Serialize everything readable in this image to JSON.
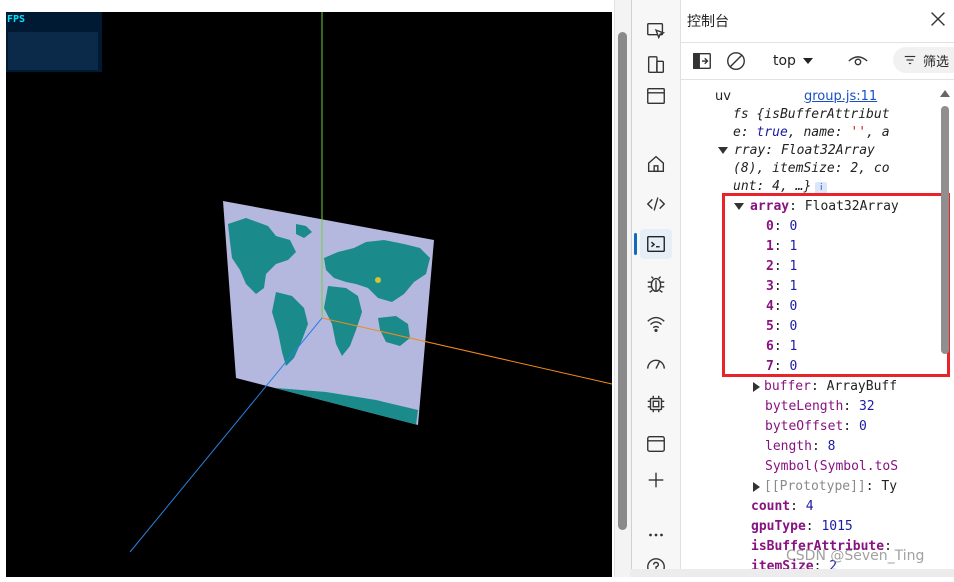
{
  "viewport": {
    "fps_label": "FPS"
  },
  "devtools": {
    "panel_title": "控制台",
    "toolbar": {
      "context": "top",
      "filter_label": "筛选"
    }
  },
  "console": {
    "log_label": "uv",
    "source_link": "group.js:11",
    "summary": {
      "line1": "fs {isBufferAttribut",
      "line2_prefix": "e: ",
      "line2_true": "true",
      "line2_mid": ", name: ",
      "line2_str": "''",
      "line2_end": ", a",
      "line3": "rray: Float32Array",
      "line4": "(8), itemSize: 2, co",
      "line5": "unt: 4, …}",
      "info": "i"
    },
    "array": {
      "key": "array",
      "type": "Float32Array",
      "entries": [
        {
          "k": "0",
          "v": "0"
        },
        {
          "k": "1",
          "v": "1"
        },
        {
          "k": "2",
          "v": "1"
        },
        {
          "k": "3",
          "v": "1"
        },
        {
          "k": "4",
          "v": "0"
        },
        {
          "k": "5",
          "v": "0"
        },
        {
          "k": "6",
          "v": "1"
        },
        {
          "k": "7",
          "v": "0"
        }
      ]
    },
    "buffer": {
      "key": "buffer",
      "value": "ArrayBuff"
    },
    "byteLength": {
      "key": "byteLength",
      "value": "32"
    },
    "byteOffset": {
      "key": "byteOffset",
      "value": "0"
    },
    "length": {
      "key": "length",
      "value": "8"
    },
    "symbol": {
      "text": "Symbol(Symbol.toS"
    },
    "prototype": {
      "key": "[[Prototype]]",
      "value": "Ty"
    },
    "count": {
      "key": "count",
      "value": "4"
    },
    "gpuType": {
      "key": "gpuType",
      "value": "1015"
    },
    "isBufferAttribute": {
      "key": "isBufferAttribute"
    },
    "itemSize": {
      "key": "itemSize",
      "value": "2"
    }
  },
  "watermark": "CSDN @Seven_Ting",
  "icons": {
    "activity": [
      "inspect-icon",
      "device-emulation-icon",
      "browser-window-icon",
      "home-icon",
      "code-icon",
      "console-icon",
      "bug-icon",
      "wifi-icon",
      "performance-gauge-icon",
      "chip-icon",
      "application-icon",
      "plus-icon",
      "more-icon",
      "help-icon"
    ],
    "toolbar": [
      "dock-icon",
      "clear-icon",
      "chevron-down-icon",
      "eye-icon",
      "filter-icon"
    ]
  },
  "colors": {
    "accent": "#0f6cbd",
    "highlight_box": "#e8242a",
    "scene_bg": "#000000",
    "texture_land": "#1a8a8a",
    "texture_sea": "#b4b8de"
  }
}
